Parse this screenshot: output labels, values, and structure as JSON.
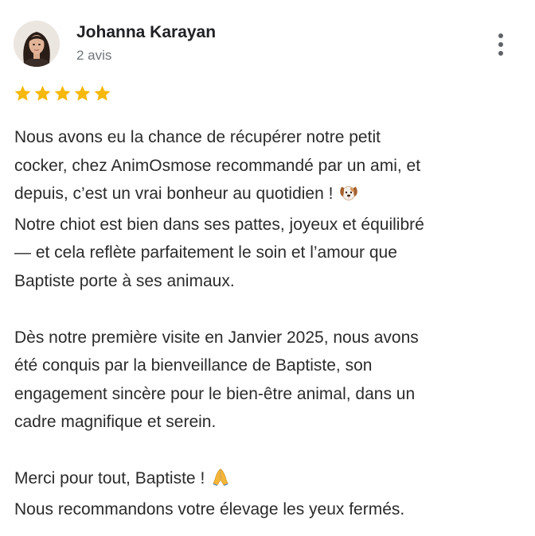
{
  "review": {
    "author": {
      "name": "Johanna Karayan",
      "review_count": "2 avis",
      "avatar_icon": "profile-photo"
    },
    "rating": {
      "stars": 5,
      "max": 5,
      "color": "#f6b80b"
    },
    "menu_icon": "more-vertical-icon",
    "text": {
      "line1": "Nous avons eu la chance de récupérer notre petit",
      "line2": "cocker, chez AnimOsmose recommandé par un ami, et",
      "line3": "depuis, c’est un vrai bonheur au quotidien !",
      "line3_emoji": "dog-face-emoji",
      "line4": "Notre chiot est bien dans ses pattes, joyeux et équilibré",
      "line5": "— et cela reflète parfaitement le soin et l’amour que",
      "line6": "Baptiste porte à ses animaux.",
      "line7": "Dès notre première visite en Janvier 2025, nous avons",
      "line8": "été conquis par la bienveillance de Baptiste, son",
      "line9": "engagement sincère pour le bien-être animal, dans un",
      "line10": "cadre magnifique et serein.",
      "line11": "Merci pour tout, Baptiste !",
      "line11_emoji": "folded-hands-emoji",
      "line12": "Nous recommandons votre élevage les yeux fermés."
    }
  }
}
